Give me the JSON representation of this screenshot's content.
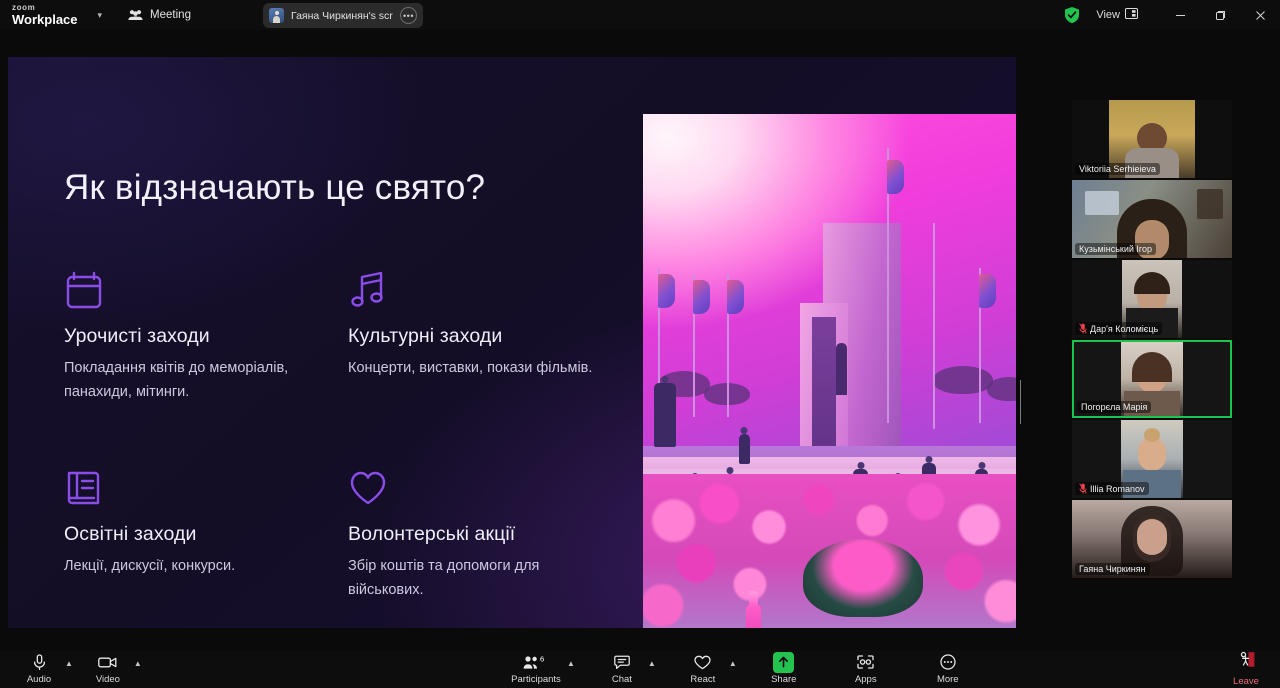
{
  "titlebar": {
    "brand_small": "zoom",
    "brand_main": "Workplace",
    "meeting_label": "Meeting",
    "share_title": "Гаяна Чиркинян's screen",
    "share_more_label": "•••",
    "view_label": "View",
    "minimize_label": "–",
    "maximize_label": "❐",
    "close_label": "✕",
    "accent_green": "#24c24f"
  },
  "slide": {
    "title": "Як відзначають це свято?",
    "features": [
      {
        "icon": "calendar-icon",
        "heading": "Урочисті заходи",
        "body": "Покладання квітів до меморіалів, панахиди, мітинги."
      },
      {
        "icon": "music-note-icon",
        "heading": "Культурні заходи",
        "body": "Концерти, виставки, покази фільмів."
      },
      {
        "icon": "book-icon",
        "heading": "Освітні заходи",
        "body": "Лекції, дискусії, конкурси."
      },
      {
        "icon": "heart-icon",
        "heading": "Волонтерські акції",
        "body": "Збір коштів та допомоги для військових."
      }
    ],
    "accent_purple": "#8a4dea",
    "background": "#16102c"
  },
  "participants": [
    {
      "name": "Viktoriia Serhieieva",
      "muted": false,
      "active_speaker": false
    },
    {
      "name": "Кузьмінський Ігор",
      "muted": false,
      "active_speaker": false
    },
    {
      "name": "Дар'я Коломієць",
      "muted": true,
      "active_speaker": false
    },
    {
      "name": "Погорєла Марія",
      "muted": false,
      "active_speaker": true
    },
    {
      "name": "Illia Romanov",
      "muted": true,
      "active_speaker": false
    },
    {
      "name": "Гаяна Чиркинян",
      "muted": false,
      "active_speaker": false
    }
  ],
  "toolbar": {
    "audio_label": "Audio",
    "video_label": "Video",
    "participants_label": "Participants",
    "participants_count": "6",
    "chat_label": "Chat",
    "react_label": "React",
    "share_label": "Share",
    "apps_label": "Apps",
    "more_label": "More",
    "leave_label": "Leave",
    "leave_color": "#e96a74",
    "share_active_color": "#24c24f"
  }
}
